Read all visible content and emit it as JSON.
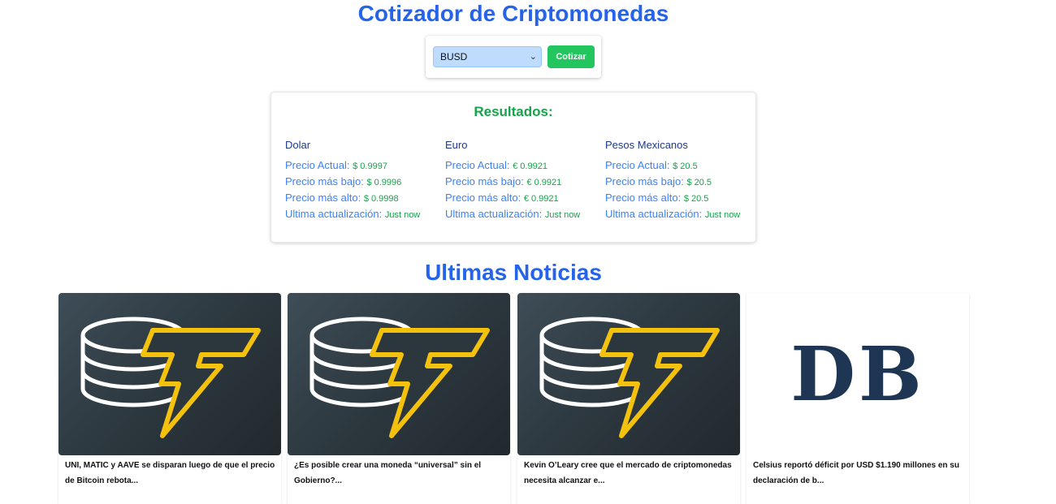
{
  "header": {
    "title": "Cotizador de Criptomonedas"
  },
  "form": {
    "selected_coin": "BUSD",
    "submit_label": "Cotizar"
  },
  "results": {
    "title": "Resultados:",
    "columns": [
      {
        "heading": "Dolar",
        "rows": [
          {
            "label": "Precio Actual:",
            "value": "$ 0.9997"
          },
          {
            "label": "Precio más bajo:",
            "value": "$ 0.9996"
          },
          {
            "label": "Precio más alto:",
            "value": "$ 0.9998"
          },
          {
            "label": "Ultima actualización:",
            "value": "Just now"
          }
        ]
      },
      {
        "heading": "Euro",
        "rows": [
          {
            "label": "Precio Actual:",
            "value": "€ 0.9921"
          },
          {
            "label": "Precio más bajo:",
            "value": "€ 0.9921"
          },
          {
            "label": "Precio más alto:",
            "value": "€ 0.9921"
          },
          {
            "label": "Ultima actualización:",
            "value": "Just now"
          }
        ]
      },
      {
        "heading": "Pesos Mexicanos",
        "rows": [
          {
            "label": "Precio Actual:",
            "value": "$ 20.5"
          },
          {
            "label": "Precio más bajo:",
            "value": "$ 20.5"
          },
          {
            "label": "Precio más alto:",
            "value": "$ 20.5"
          },
          {
            "label": "Ultima actualización:",
            "value": "Just now"
          }
        ]
      }
    ]
  },
  "news": {
    "title": "Ultimas Noticias",
    "items": [
      {
        "headline": "UNI, MATIC y AAVE se disparan luego de que el precio de Bitcoin rebota...",
        "image_icon": "coin-bolt-logo-icon"
      },
      {
        "headline": "¿Es posible crear una moneda “universal” sin el Gobierno?...",
        "image_icon": "coin-bolt-logo-icon"
      },
      {
        "headline": "Kevin O’Leary cree que el mercado de criptomonedas necesita alcanzar e...",
        "image_icon": "coin-bolt-logo-icon"
      },
      {
        "headline": "Celsius reportó déficit por USD $1.190 millones en su declaración de b...",
        "image_icon": "db-logo-icon",
        "logo_text": "DB"
      }
    ]
  },
  "colors": {
    "title_blue": "#2563eb",
    "accent_green": "#16a34a",
    "button_green": "#22c55e",
    "select_bg": "#bfdbfe",
    "logo_gold": "#f4c20d",
    "db_navy": "#1e3553"
  }
}
